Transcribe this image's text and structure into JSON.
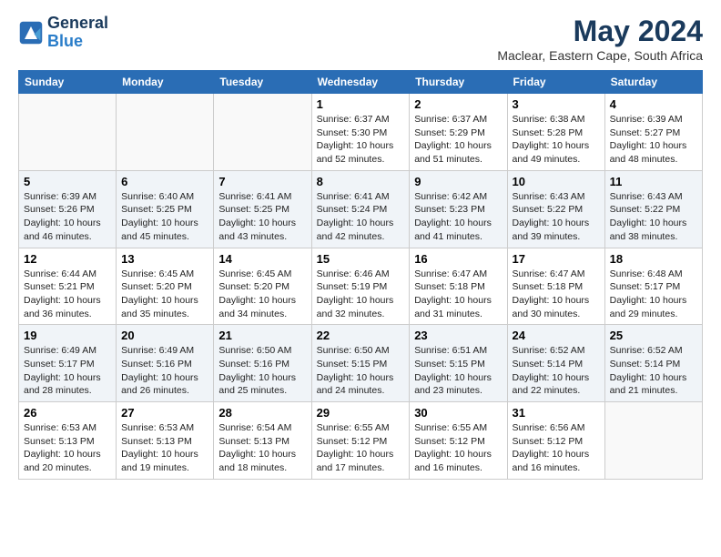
{
  "logo": {
    "line1": "General",
    "line2": "Blue"
  },
  "title": "May 2024",
  "location": "Maclear, Eastern Cape, South Africa",
  "days_of_week": [
    "Sunday",
    "Monday",
    "Tuesday",
    "Wednesday",
    "Thursday",
    "Friday",
    "Saturday"
  ],
  "weeks": [
    [
      {
        "day": null
      },
      {
        "day": null
      },
      {
        "day": null
      },
      {
        "day": "1",
        "sunrise": "6:37 AM",
        "sunset": "5:30 PM",
        "daylight": "10 hours and 52 minutes."
      },
      {
        "day": "2",
        "sunrise": "6:37 AM",
        "sunset": "5:29 PM",
        "daylight": "10 hours and 51 minutes."
      },
      {
        "day": "3",
        "sunrise": "6:38 AM",
        "sunset": "5:28 PM",
        "daylight": "10 hours and 49 minutes."
      },
      {
        "day": "4",
        "sunrise": "6:39 AM",
        "sunset": "5:27 PM",
        "daylight": "10 hours and 48 minutes."
      }
    ],
    [
      {
        "day": "5",
        "sunrise": "6:39 AM",
        "sunset": "5:26 PM",
        "daylight": "10 hours and 46 minutes."
      },
      {
        "day": "6",
        "sunrise": "6:40 AM",
        "sunset": "5:25 PM",
        "daylight": "10 hours and 45 minutes."
      },
      {
        "day": "7",
        "sunrise": "6:41 AM",
        "sunset": "5:25 PM",
        "daylight": "10 hours and 43 minutes."
      },
      {
        "day": "8",
        "sunrise": "6:41 AM",
        "sunset": "5:24 PM",
        "daylight": "10 hours and 42 minutes."
      },
      {
        "day": "9",
        "sunrise": "6:42 AM",
        "sunset": "5:23 PM",
        "daylight": "10 hours and 41 minutes."
      },
      {
        "day": "10",
        "sunrise": "6:43 AM",
        "sunset": "5:22 PM",
        "daylight": "10 hours and 39 minutes."
      },
      {
        "day": "11",
        "sunrise": "6:43 AM",
        "sunset": "5:22 PM",
        "daylight": "10 hours and 38 minutes."
      }
    ],
    [
      {
        "day": "12",
        "sunrise": "6:44 AM",
        "sunset": "5:21 PM",
        "daylight": "10 hours and 36 minutes."
      },
      {
        "day": "13",
        "sunrise": "6:45 AM",
        "sunset": "5:20 PM",
        "daylight": "10 hours and 35 minutes."
      },
      {
        "day": "14",
        "sunrise": "6:45 AM",
        "sunset": "5:20 PM",
        "daylight": "10 hours and 34 minutes."
      },
      {
        "day": "15",
        "sunrise": "6:46 AM",
        "sunset": "5:19 PM",
        "daylight": "10 hours and 32 minutes."
      },
      {
        "day": "16",
        "sunrise": "6:47 AM",
        "sunset": "5:18 PM",
        "daylight": "10 hours and 31 minutes."
      },
      {
        "day": "17",
        "sunrise": "6:47 AM",
        "sunset": "5:18 PM",
        "daylight": "10 hours and 30 minutes."
      },
      {
        "day": "18",
        "sunrise": "6:48 AM",
        "sunset": "5:17 PM",
        "daylight": "10 hours and 29 minutes."
      }
    ],
    [
      {
        "day": "19",
        "sunrise": "6:49 AM",
        "sunset": "5:17 PM",
        "daylight": "10 hours and 28 minutes."
      },
      {
        "day": "20",
        "sunrise": "6:49 AM",
        "sunset": "5:16 PM",
        "daylight": "10 hours and 26 minutes."
      },
      {
        "day": "21",
        "sunrise": "6:50 AM",
        "sunset": "5:16 PM",
        "daylight": "10 hours and 25 minutes."
      },
      {
        "day": "22",
        "sunrise": "6:50 AM",
        "sunset": "5:15 PM",
        "daylight": "10 hours and 24 minutes."
      },
      {
        "day": "23",
        "sunrise": "6:51 AM",
        "sunset": "5:15 PM",
        "daylight": "10 hours and 23 minutes."
      },
      {
        "day": "24",
        "sunrise": "6:52 AM",
        "sunset": "5:14 PM",
        "daylight": "10 hours and 22 minutes."
      },
      {
        "day": "25",
        "sunrise": "6:52 AM",
        "sunset": "5:14 PM",
        "daylight": "10 hours and 21 minutes."
      }
    ],
    [
      {
        "day": "26",
        "sunrise": "6:53 AM",
        "sunset": "5:13 PM",
        "daylight": "10 hours and 20 minutes."
      },
      {
        "day": "27",
        "sunrise": "6:53 AM",
        "sunset": "5:13 PM",
        "daylight": "10 hours and 19 minutes."
      },
      {
        "day": "28",
        "sunrise": "6:54 AM",
        "sunset": "5:13 PM",
        "daylight": "10 hours and 18 minutes."
      },
      {
        "day": "29",
        "sunrise": "6:55 AM",
        "sunset": "5:12 PM",
        "daylight": "10 hours and 17 minutes."
      },
      {
        "day": "30",
        "sunrise": "6:55 AM",
        "sunset": "5:12 PM",
        "daylight": "10 hours and 16 minutes."
      },
      {
        "day": "31",
        "sunrise": "6:56 AM",
        "sunset": "5:12 PM",
        "daylight": "10 hours and 16 minutes."
      },
      {
        "day": null
      }
    ]
  ]
}
